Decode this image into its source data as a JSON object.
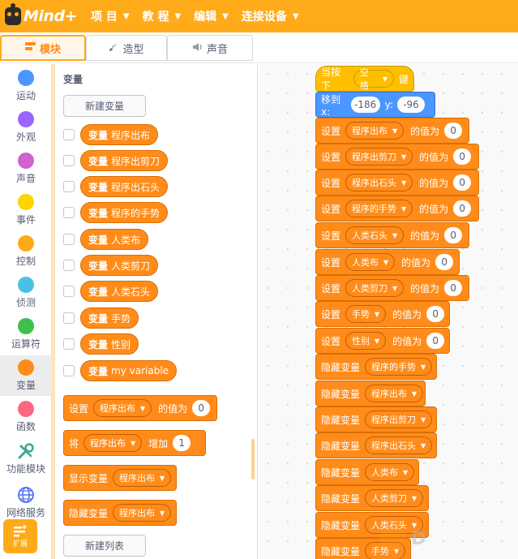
{
  "app": {
    "logo_text": "Mind+",
    "accent": "#ffab19"
  },
  "menu": [
    {
      "label": "项 目"
    },
    {
      "label": "教 程"
    },
    {
      "label": "编辑"
    },
    {
      "label": "连接设备"
    }
  ],
  "tabs": [
    {
      "label": "模块",
      "icon": "blocks-icon",
      "active": true
    },
    {
      "label": "造型",
      "icon": "brush-icon"
    },
    {
      "label": "声音",
      "icon": "speaker-icon"
    }
  ],
  "categories": [
    {
      "label": "运动",
      "color": "#4c97ff"
    },
    {
      "label": "外观",
      "color": "#9966ff"
    },
    {
      "label": "声音",
      "color": "#cf63cf"
    },
    {
      "label": "事件",
      "color": "#ffd500"
    },
    {
      "label": "控制",
      "color": "#ffab19"
    },
    {
      "label": "侦测",
      "color": "#4cbfe6"
    },
    {
      "label": "运算符",
      "color": "#40bf4a"
    },
    {
      "label": "变量",
      "color": "#ff8c1a",
      "active": true
    },
    {
      "label": "函数",
      "color": "#ff6680"
    },
    {
      "label": "功能模块",
      "icon": "tools-icon"
    },
    {
      "label": "网络服务",
      "icon": "globe-icon"
    }
  ],
  "extension_button": {
    "label": "扩展"
  },
  "palette": {
    "title": "变量",
    "new_variable_button": "新建变量",
    "new_list_button": "新建列表",
    "var_prefix": "变量",
    "variables": [
      "程序出布",
      "程序出剪刀",
      "程序出石头",
      "程序的手势",
      "人类布",
      "人类剪刀",
      "人类石头",
      "手势",
      "性别",
      "my variable"
    ],
    "blocks": {
      "set": {
        "word": "设置",
        "var": "程序出布",
        "mid": "的值为",
        "value": "0"
      },
      "change": {
        "word": "将",
        "var": "程序出布",
        "mid": "增加",
        "value": "1"
      },
      "show": {
        "word": "显示变量",
        "var": "程序出布"
      },
      "hide": {
        "word": "隐藏变量",
        "var": "程序出布"
      }
    }
  },
  "workspace": {
    "hat": {
      "pre": "当按下",
      "key": "空格",
      "post": "键"
    },
    "goto": {
      "word": "移到 x:",
      "x": "-186",
      "ylabel": "y:",
      "y": "-96"
    },
    "set_word": "设置",
    "set_mid": "的值为",
    "set_blocks": [
      {
        "var": "程序出布",
        "value": "0"
      },
      {
        "var": "程序出剪刀",
        "value": "0"
      },
      {
        "var": "程序出石头",
        "value": "0"
      },
      {
        "var": "程序的手势",
        "value": "0"
      },
      {
        "var": "人类石头",
        "value": "0"
      },
      {
        "var": "人类布",
        "value": "0"
      },
      {
        "var": "人类剪刀",
        "value": "0"
      },
      {
        "var": "手势",
        "value": "0"
      },
      {
        "var": "性别",
        "value": "0"
      }
    ],
    "hide_word": "隐藏变量",
    "hide_blocks": [
      "程序的手势",
      "程序出布",
      "程序出剪刀",
      "程序出石头",
      "人类布",
      "人类剪刀",
      "人类石头",
      "手势"
    ]
  }
}
